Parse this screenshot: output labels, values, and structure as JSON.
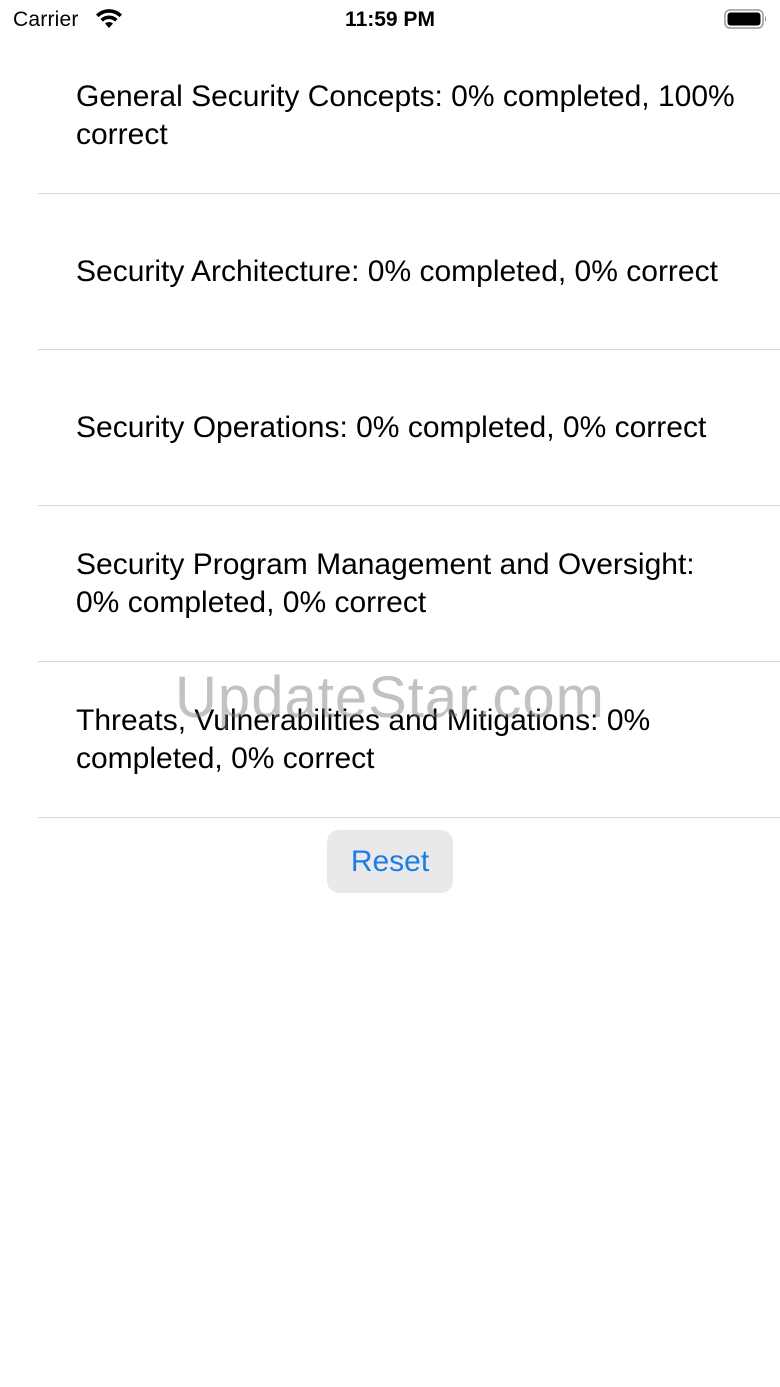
{
  "status_bar": {
    "carrier": "Carrier",
    "time": "11:59 PM",
    "wifi_icon": "wifi-icon",
    "battery_icon": "battery-icon"
  },
  "categories": [
    {
      "text": "General Security Concepts: 0% completed, 100% correct"
    },
    {
      "text": "Security Architecture: 0% completed, 0% correct"
    },
    {
      "text": "Security Operations: 0% completed, 0% correct"
    },
    {
      "text": "Security Program Management and Oversight: 0% completed, 0% correct"
    },
    {
      "text": "Threats, Vulnerabilities and Mitigations: 0% completed, 0% correct"
    }
  ],
  "reset_label": "Reset",
  "watermark": "UpdateStar.com",
  "colors": {
    "accent": "#1a7ee6",
    "button_bg": "#e9e9eb",
    "separator": "#d8d8dc"
  }
}
